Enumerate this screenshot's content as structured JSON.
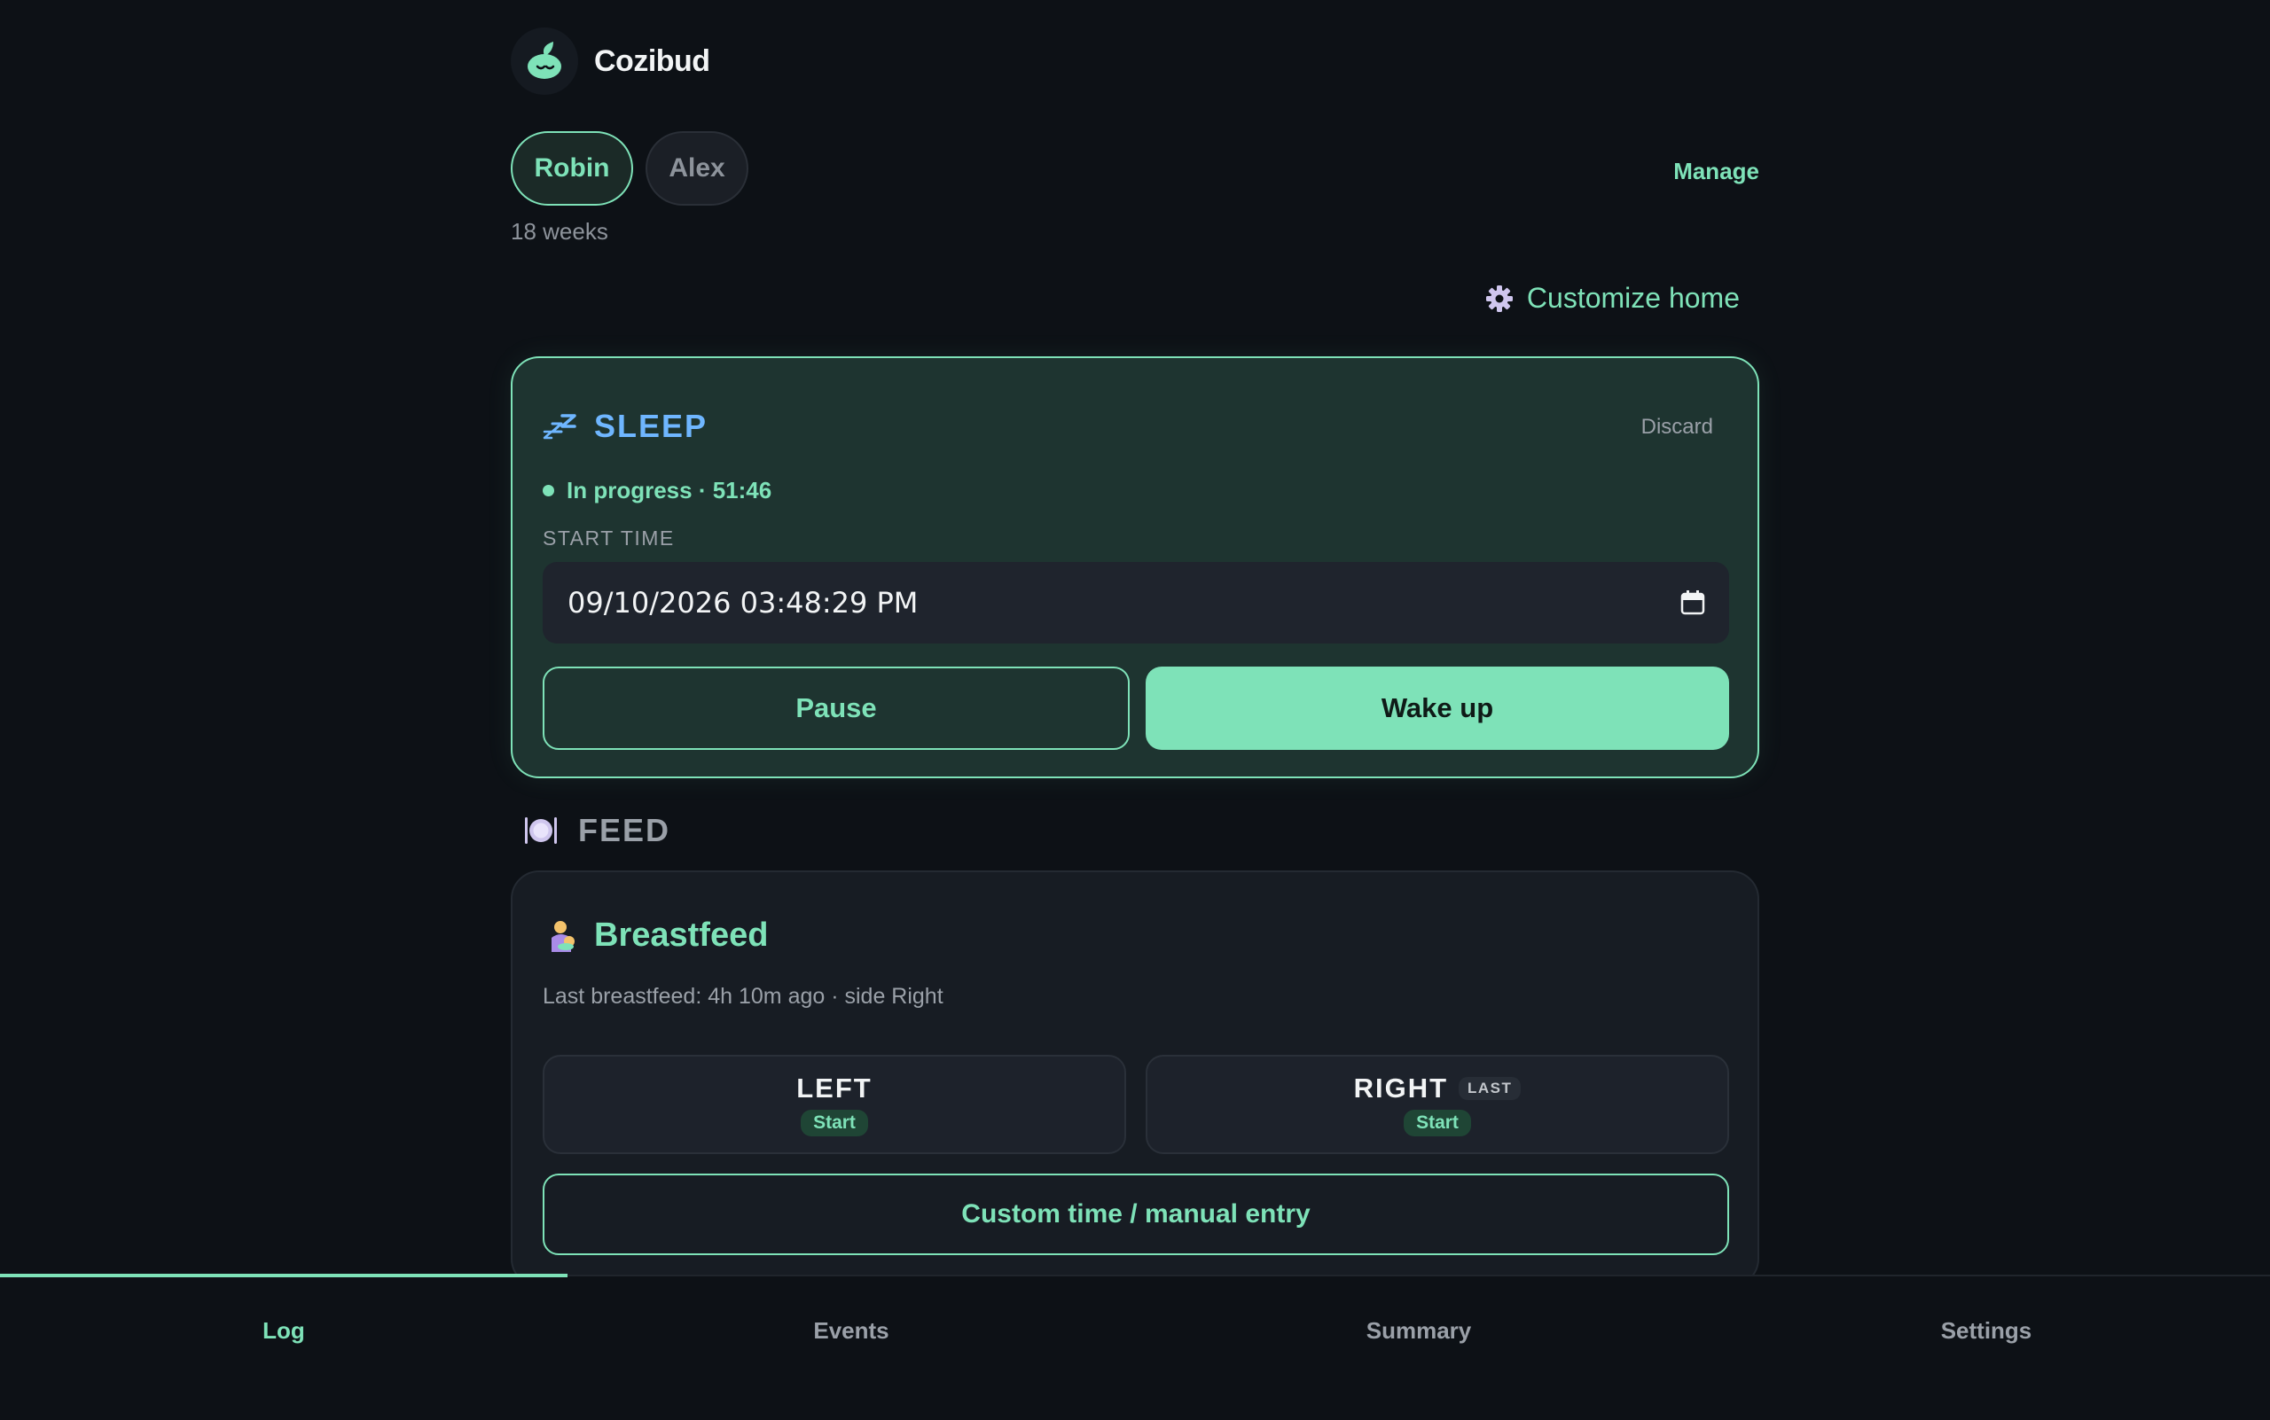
{
  "app": {
    "name": "Cozibud"
  },
  "profiles": {
    "tabs": [
      {
        "label": "Robin",
        "active": true
      },
      {
        "label": "Alex",
        "active": false
      }
    ],
    "manage_label": "Manage",
    "age": "18 weeks"
  },
  "customize": {
    "label": "Customize home",
    "icon": "gear-icon"
  },
  "sleep": {
    "icon": "zzz-icon",
    "title": "SLEEP",
    "discard_label": "Discard",
    "status": "In progress · 51:46",
    "start_label": "START TIME",
    "start_value": "09/10/2026 03:48:29 PM",
    "pause_label": "Pause",
    "wake_label": "Wake up"
  },
  "feed": {
    "section_icon": "plate-cutlery-icon",
    "section_title": "FEED",
    "breastfeed": {
      "icon": "breastfeeding-icon",
      "title": "Breastfeed",
      "last_info": "Last breastfeed: 4h 10m ago · side Right",
      "left": {
        "label": "LEFT",
        "action": "Start"
      },
      "right": {
        "label": "RIGHT",
        "tag": "LAST",
        "action": "Start"
      },
      "custom_label": "Custom time / manual entry"
    }
  },
  "nav": {
    "items": [
      {
        "label": "Log",
        "active": true
      },
      {
        "label": "Events",
        "active": false
      },
      {
        "label": "Summary",
        "active": false
      },
      {
        "label": "Settings",
        "active": false
      }
    ]
  },
  "colors": {
    "accent": "#7ee2b8",
    "background": "#0d1116",
    "sleep_title": "#6fb6ff",
    "card_active": "#1e3430",
    "card": "#171c23"
  }
}
